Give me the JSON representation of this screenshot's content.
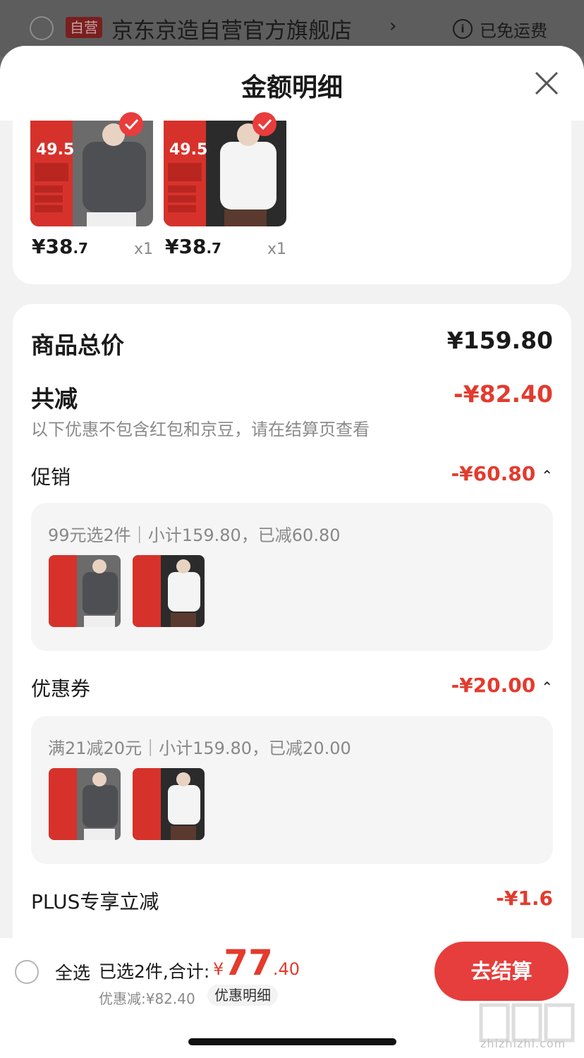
{
  "store_bar": {
    "badge": "自营",
    "name": "京东京造自营官方旗舰店",
    "shipping_note": "已免运费"
  },
  "sheet": {
    "title": "金额明细"
  },
  "products": [
    {
      "price_main": "¥38",
      "price_dec": ".7",
      "qty": "x1",
      "color": "grey",
      "promo_price": "49.5"
    },
    {
      "price_main": "¥38",
      "price_dec": ".7",
      "qty": "x1",
      "color": "white",
      "promo_price": "49.5"
    }
  ],
  "summary": {
    "total_label": "商品总价",
    "total_value": "¥159.80",
    "reduce_label": "共减",
    "reduce_value": "-¥82.40",
    "reduce_note": "以下优惠不包含红包和京豆，请在结算页查看"
  },
  "promotion": {
    "label": "促销",
    "value": "-¥60.80",
    "desc": "99元选2件｜小计159.80，已减60.80"
  },
  "coupon": {
    "label": "优惠券",
    "value": "-¥20.00",
    "desc": "满21减20元｜小计159.80，已减20.00"
  },
  "plus": {
    "label": "PLUS专享立减",
    "value": "-¥1.6"
  },
  "bottom_bar": {
    "select_all": "全选",
    "selected_text": "已选2件,合计:",
    "currency": "¥",
    "total_int": "77",
    "total_dec": ".40",
    "discount_text": "优惠减:¥82.40",
    "discount_detail": "优惠明细",
    "checkout": "去结算"
  },
  "watermark": "zhizhizhi.com",
  "colors": {
    "accent_red": "#e33b2e",
    "checkout_red": "#e53e3c",
    "overlay": "#666666"
  }
}
